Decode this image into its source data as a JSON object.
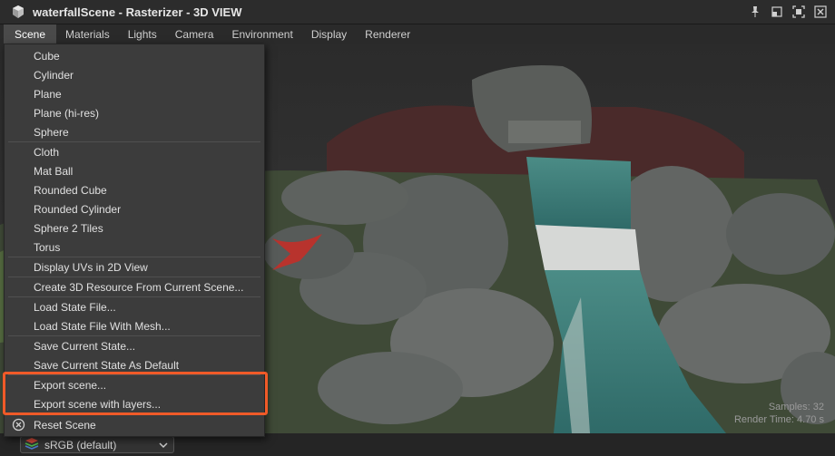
{
  "window": {
    "title": "waterfallScene - Rasterizer - 3D VIEW",
    "controls": [
      {
        "name": "pin-icon"
      },
      {
        "name": "restore-icon"
      },
      {
        "name": "maximize-icon"
      },
      {
        "name": "close-icon"
      }
    ]
  },
  "menubar": {
    "items": [
      "Scene",
      "Materials",
      "Lights",
      "Camera",
      "Environment",
      "Display",
      "Renderer"
    ],
    "active": "Scene"
  },
  "scene_menu": {
    "groups": [
      [
        "Cube",
        "Cylinder",
        "Plane",
        "Plane (hi-res)",
        "Sphere"
      ],
      [
        "Cloth",
        "Mat Ball",
        "Rounded Cube",
        "Rounded Cylinder",
        "Sphere 2 Tiles",
        "Torus"
      ],
      [
        "Display UVs in 2D View"
      ],
      [
        "Create 3D Resource From Current Scene..."
      ],
      [
        "Load State File...",
        "Load State File With Mesh..."
      ],
      [
        "Save Current State...",
        "Save Current State As Default"
      ],
      [
        "Export scene...",
        "Export scene with layers..."
      ],
      [
        "Reset Scene"
      ]
    ],
    "highlighted": [
      "Export scene...",
      "Export scene with layers..."
    ],
    "highlight_color": "#f05a28"
  },
  "viewport": {
    "samples": "Samples: 32",
    "render_time": "Render Time: 4.70 s"
  },
  "footer": {
    "color_space": "sRGB (default)"
  }
}
